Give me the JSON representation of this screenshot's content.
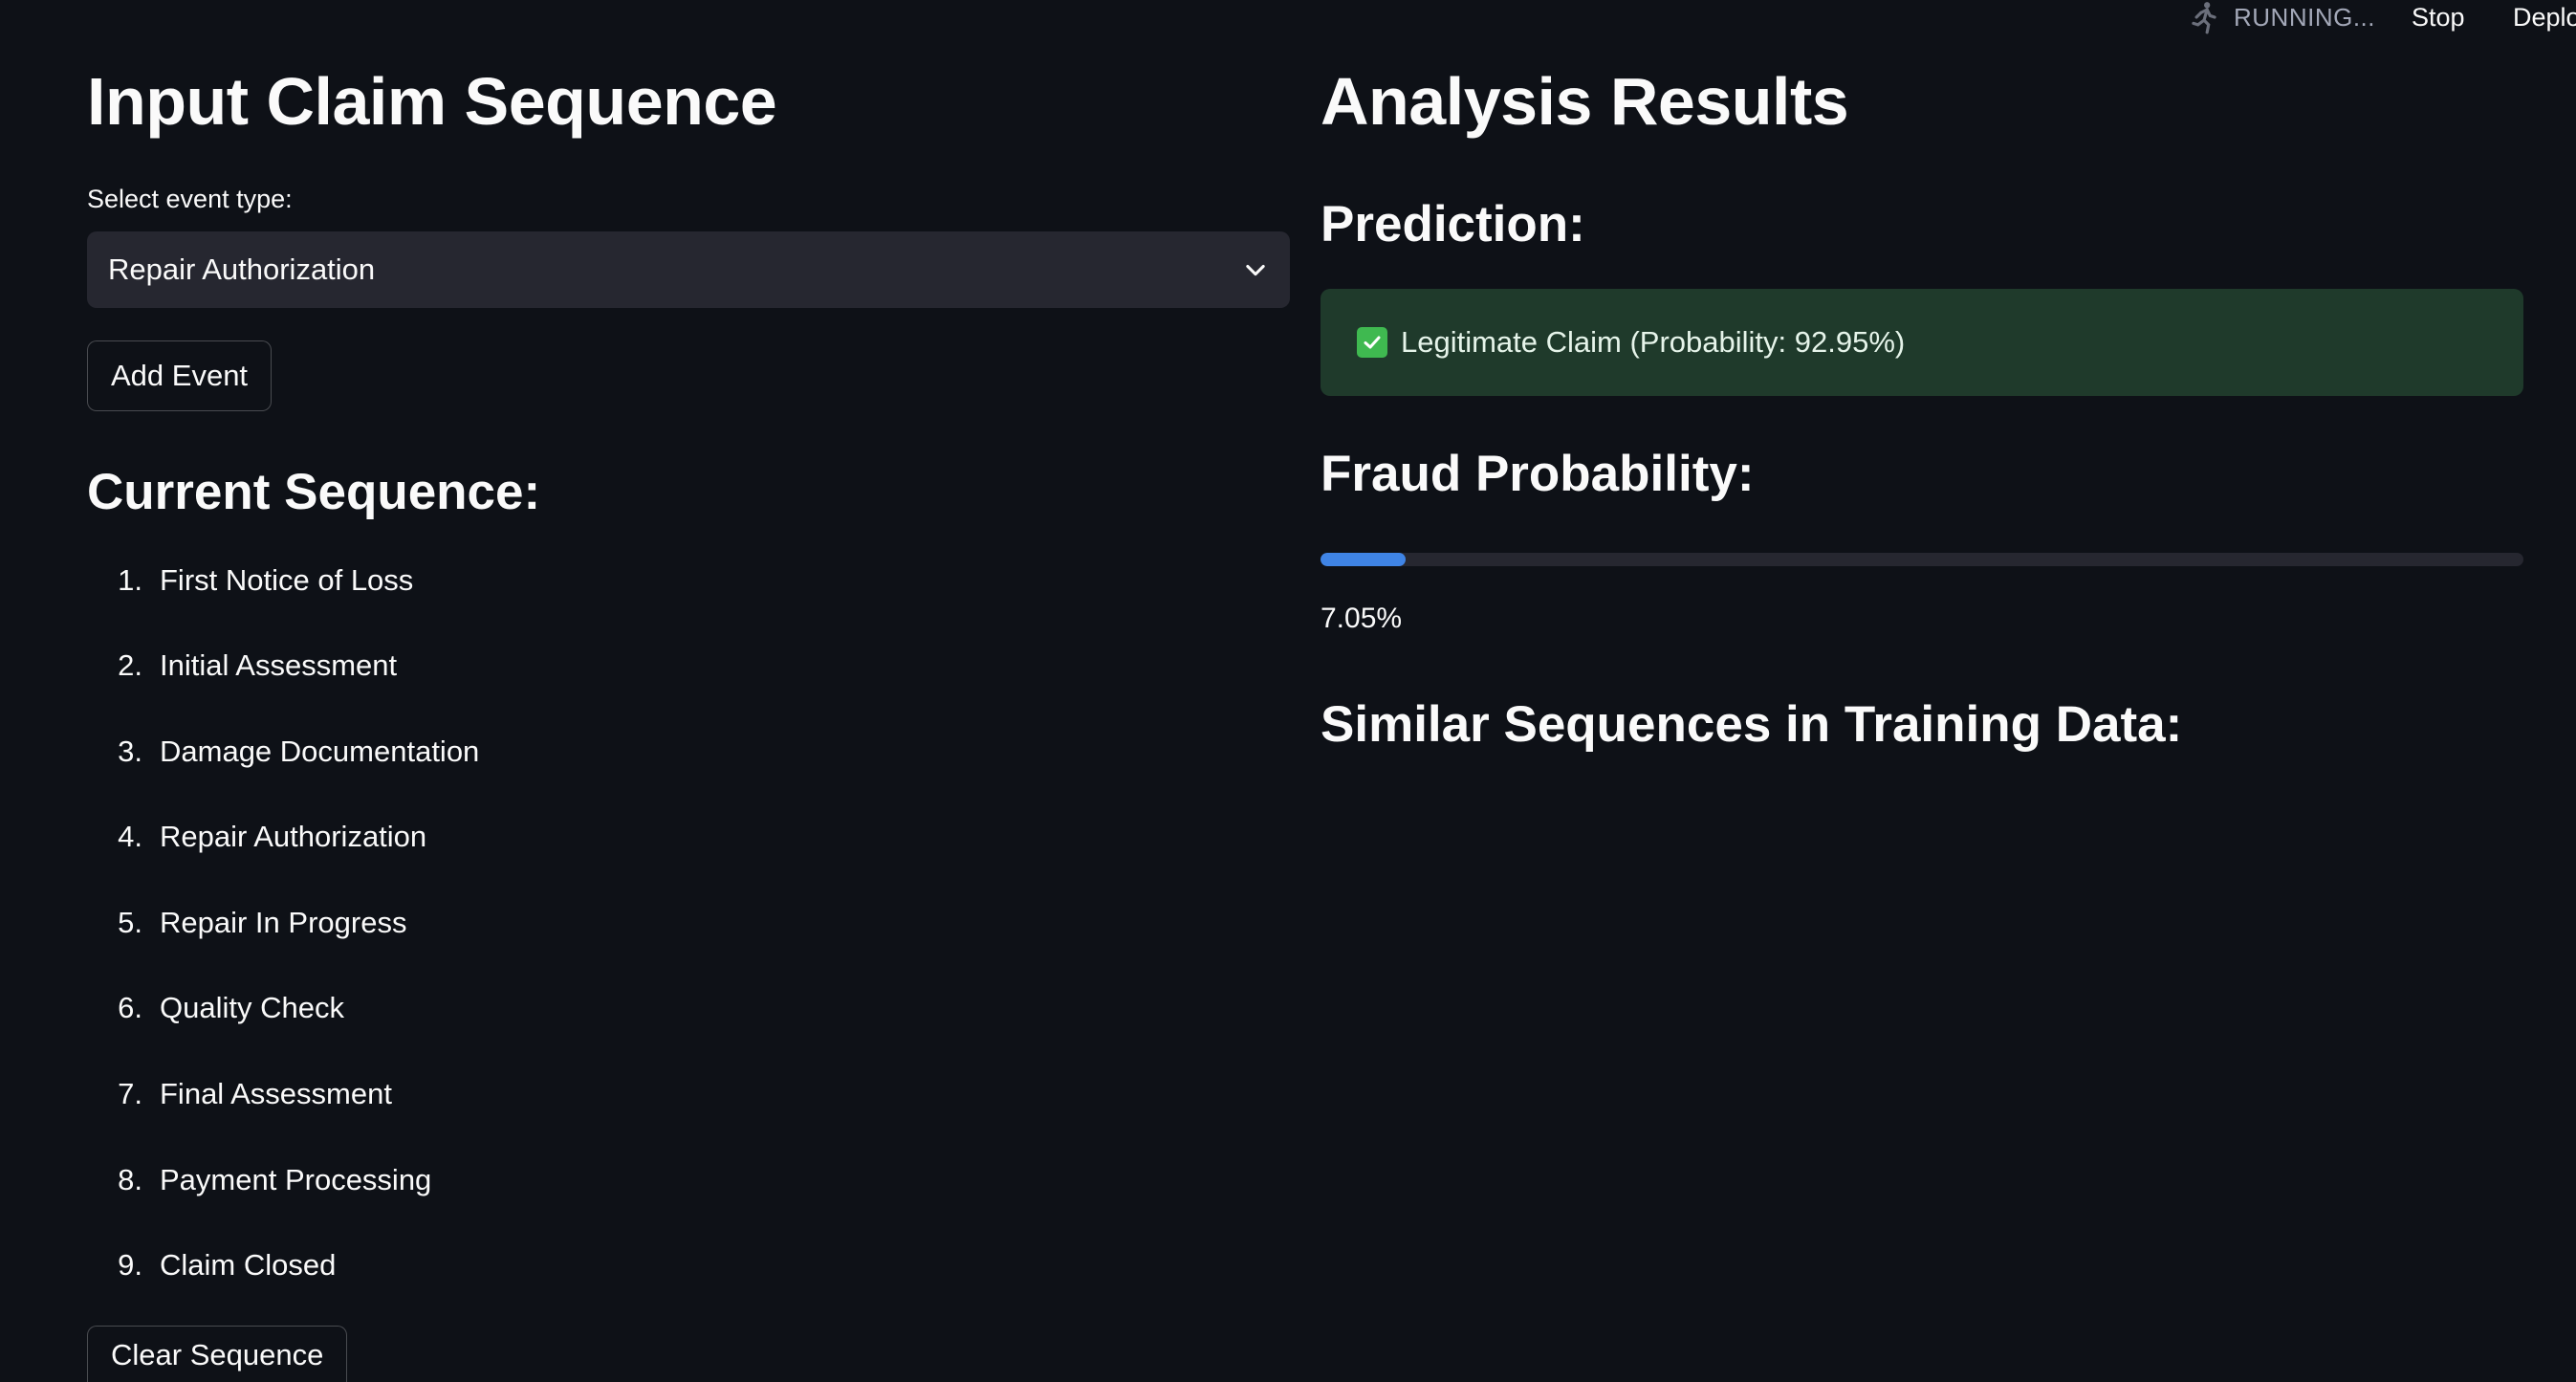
{
  "status": {
    "running_label": "RUNNING...",
    "stop_label": "Stop",
    "deploy_label": "Deplo"
  },
  "input": {
    "title": "Input Claim Sequence",
    "select_label": "Select event type:",
    "select_value": "Repair Authorization",
    "add_button": "Add Event",
    "sequence_title": "Current Sequence:",
    "sequence": [
      {
        "num": "1.",
        "label": "First Notice of Loss"
      },
      {
        "num": "2.",
        "label": "Initial Assessment"
      },
      {
        "num": "3.",
        "label": "Damage Documentation"
      },
      {
        "num": "4.",
        "label": "Repair Authorization"
      },
      {
        "num": "5.",
        "label": "Repair In Progress"
      },
      {
        "num": "6.",
        "label": "Quality Check"
      },
      {
        "num": "7.",
        "label": "Final Assessment"
      },
      {
        "num": "8.",
        "label": "Payment Processing"
      },
      {
        "num": "9.",
        "label": "Claim Closed"
      }
    ],
    "clear_button": "Clear Sequence"
  },
  "results": {
    "title": "Analysis Results",
    "prediction_title": "Prediction:",
    "prediction_text": "Legitimate Claim (Probability: 92.95%)",
    "fraud_title": "Fraud Probability:",
    "fraud_value": 0.0705,
    "fraud_text": "7.05%",
    "similar_title": "Similar Sequences in Training Data:"
  },
  "colors": {
    "background": "#0e1117",
    "accent": "#3f84e5",
    "success_bg": "#1f3a2b",
    "success_check": "#3fb950"
  }
}
